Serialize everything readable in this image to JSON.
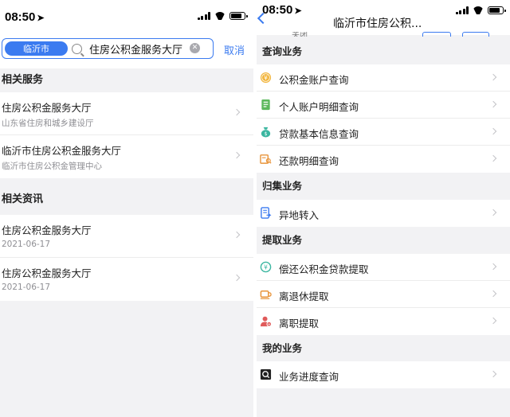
{
  "left": {
    "status": {
      "time": "08:50"
    },
    "search": {
      "city": "临沂市",
      "query": "住房公积金服务大厅",
      "cancel": "取消"
    },
    "related_services": {
      "heading": "相关服务",
      "items": [
        {
          "title": "住房公积金服务大厅",
          "subtitle": "山东省住房和城乡建设厅"
        },
        {
          "title": "临沂市住房公积金服务大厅",
          "subtitle": "临沂市住房公积金管理中心"
        }
      ]
    },
    "related_news": {
      "heading": "相关资讯",
      "items": [
        {
          "title": "住房公积金服务大厅",
          "date": "2021-06-17"
        },
        {
          "title": "住房公积金服务大厅",
          "date": "2021-06-17"
        }
      ]
    }
  },
  "right": {
    "status": {
      "time": "08:50"
    },
    "nav_title": "临沂市住房公积...",
    "peek_text": "关闭",
    "sections": [
      {
        "heading": "查询业务",
        "items": [
          {
            "label": "公积金账户查询",
            "icon": "yen-coin-icon"
          },
          {
            "label": "个人账户明细查询",
            "icon": "document-icon"
          },
          {
            "label": "贷款基本信息查询",
            "icon": "money-bag-icon"
          },
          {
            "label": "还款明细查询",
            "icon": "receipt-search-icon"
          }
        ]
      },
      {
        "heading": "归集业务",
        "items": [
          {
            "label": "异地转入",
            "icon": "transfer-doc-icon"
          }
        ]
      },
      {
        "heading": "提取业务",
        "items": [
          {
            "label": "偿还公积金贷款提取",
            "icon": "yen-circle-icon"
          },
          {
            "label": "离退休提取",
            "icon": "cup-icon"
          },
          {
            "label": "离职提取",
            "icon": "person-minus-icon"
          }
        ]
      },
      {
        "heading": "我的业务",
        "items": [
          {
            "label": "业务进度查询",
            "icon": "progress-search-icon"
          }
        ]
      }
    ]
  }
}
